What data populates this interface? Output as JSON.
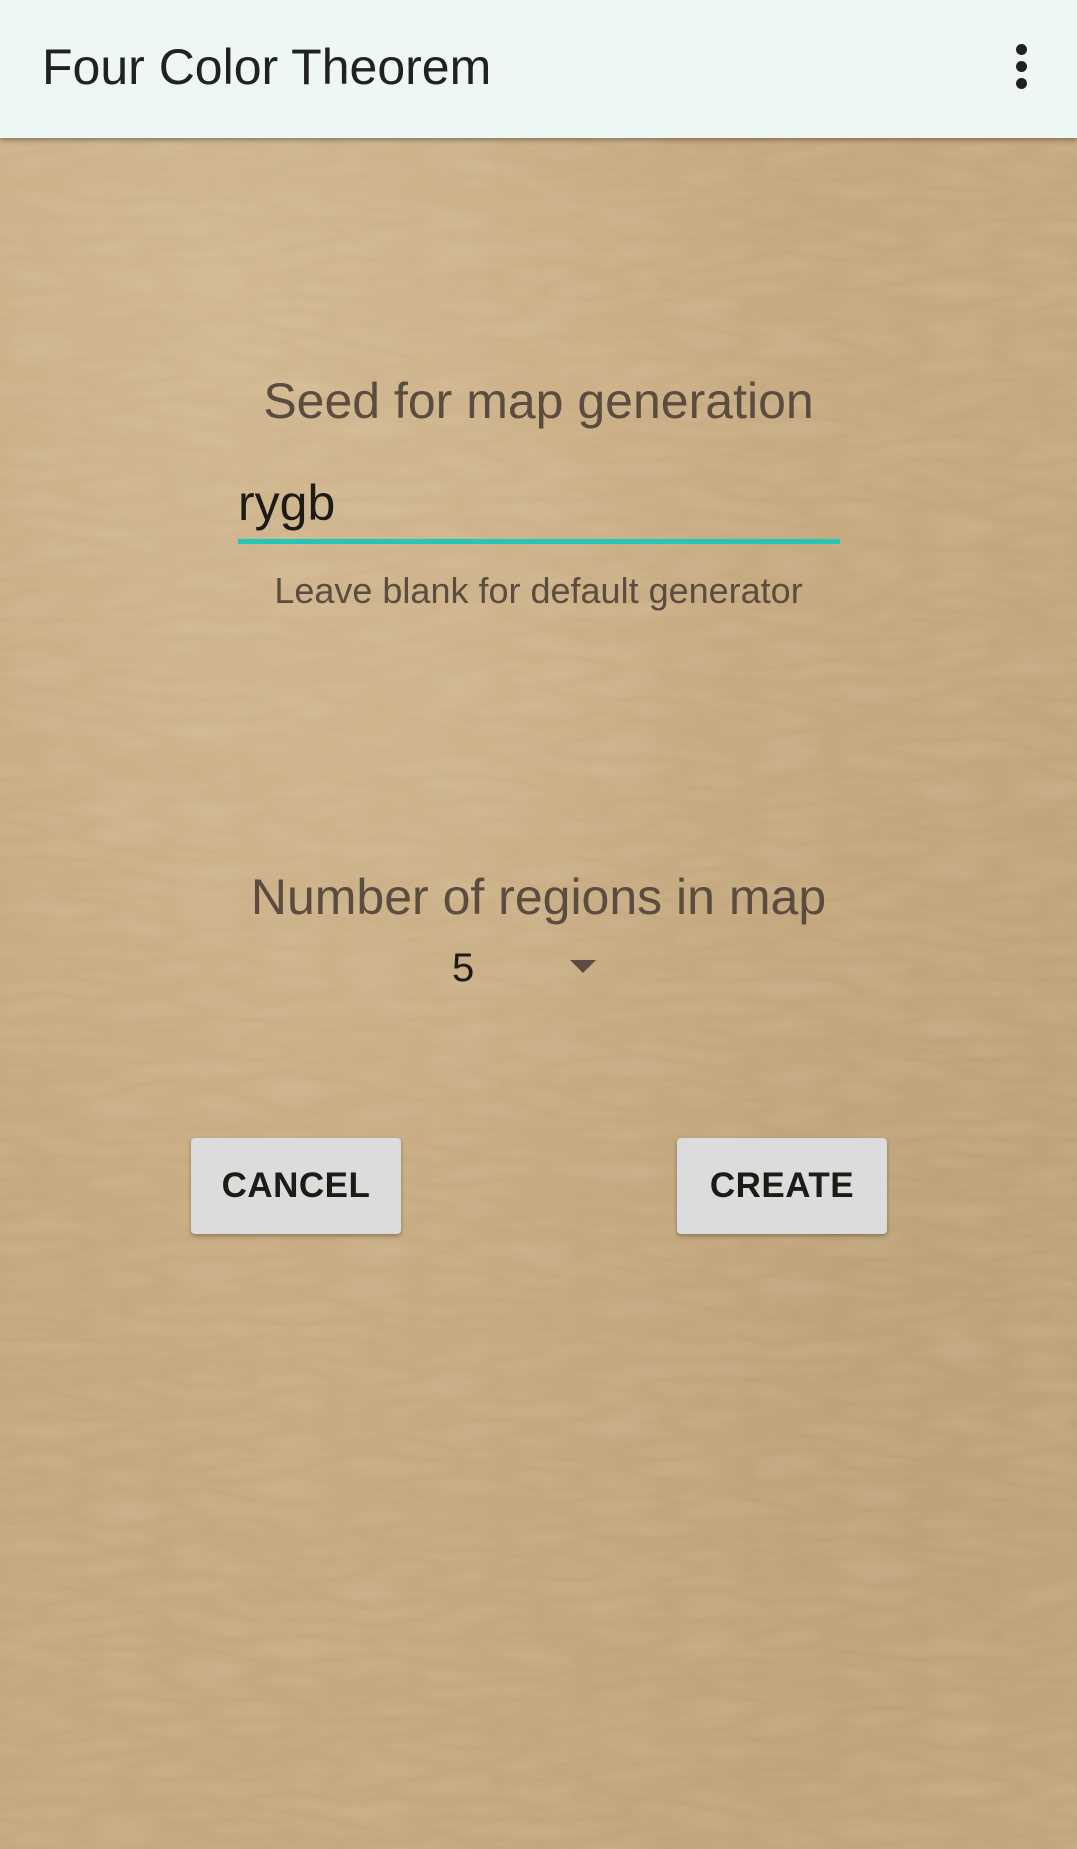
{
  "app_bar": {
    "title": "Four Color Theorem",
    "menu_icon": "more-vert-icon",
    "background_color": "#eef7f6"
  },
  "seed": {
    "label": "Seed for map generation",
    "value": "rygb",
    "hint": "Leave blank for default generator",
    "accent_color": "#26c6b4"
  },
  "regions": {
    "label": "Number of regions in map",
    "selected_value": "5",
    "dropdown_icon": "dropdown-arrow-icon"
  },
  "actions": {
    "cancel_label": "CANCEL",
    "create_label": "CREATE"
  }
}
